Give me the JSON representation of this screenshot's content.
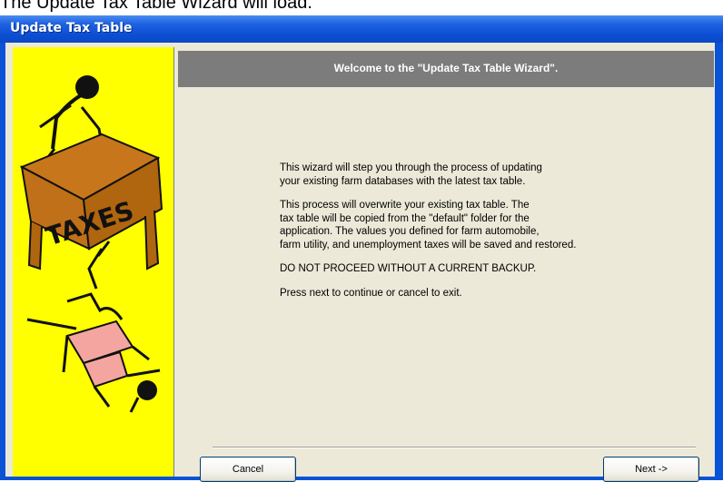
{
  "caption": "The Update Tax Table Wizard will load.",
  "window": {
    "title": "Update Tax Table"
  },
  "wizard": {
    "heading": "Welcome to the \"Update Tax Table Wizard\".",
    "paragraphs": [
      "This wizard will step you through the process of updating\nyour existing farm databases with the latest tax table.",
      "This process will overwrite your existing tax table.  The\ntax table will be copied from the \"default\" folder for the\napplication.  The values you defined for farm automobile,\nfarm utility, and unemployment taxes will be saved and restored.",
      "DO NOT PROCEED WITHOUT A CURRENT BACKUP.",
      "Press next to continue or cancel to exit."
    ],
    "illustration_text": "TAXES"
  },
  "buttons": {
    "cancel_label": "Cancel",
    "next_label": "Next ->"
  },
  "colors": {
    "titlebar": "#0a52d6",
    "sidebar": "#ffff00",
    "header_band": "#7c7c7c",
    "dialog_bg": "#ece9d8"
  },
  "icons": {
    "sidebar_art": "taxes-desk-cartoon"
  }
}
